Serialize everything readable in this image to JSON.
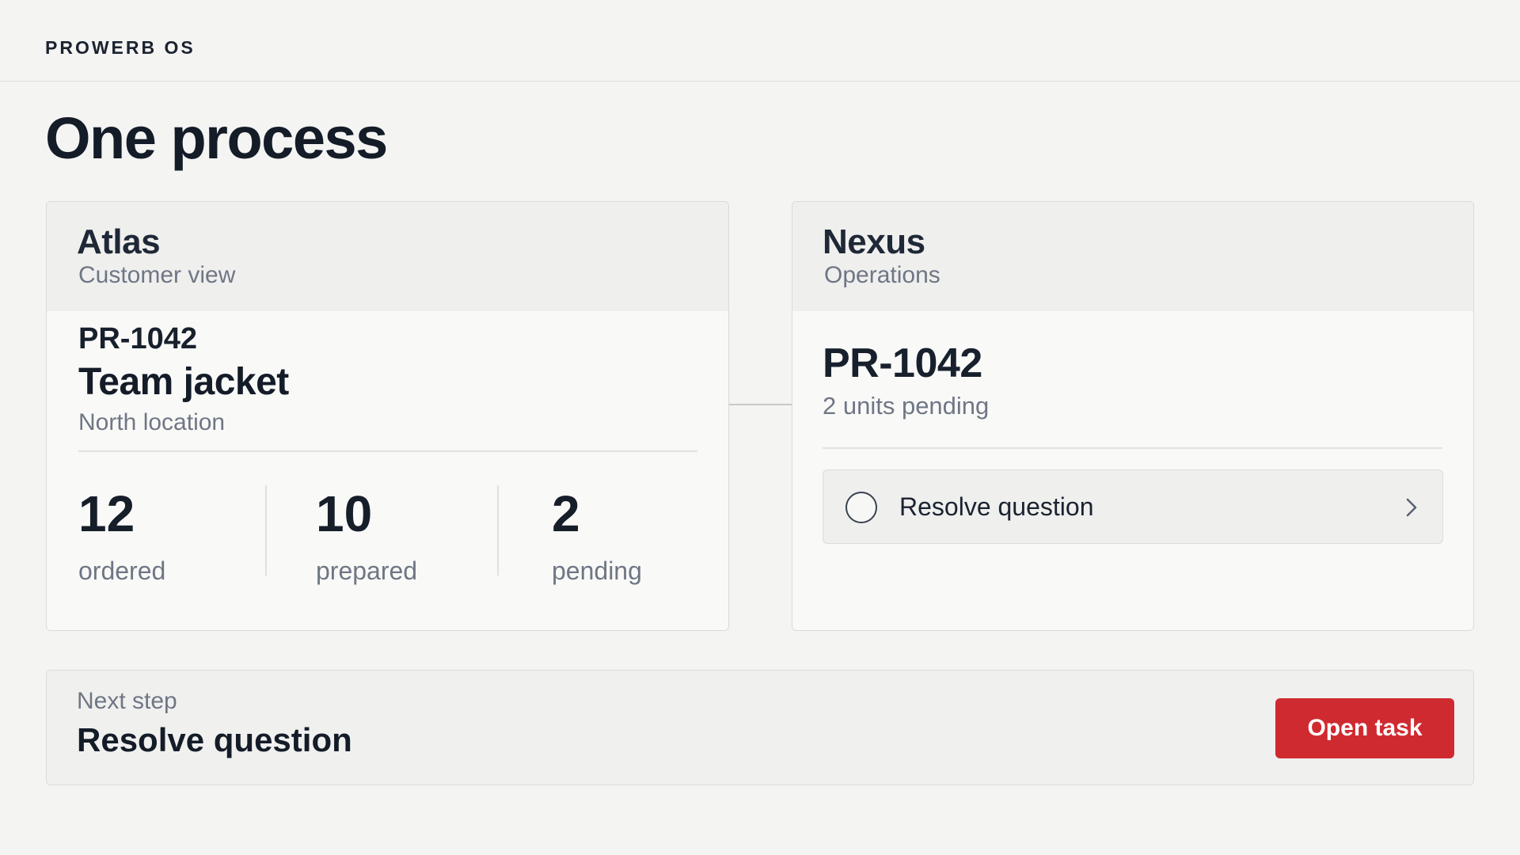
{
  "header": {
    "brand": "PROWERB OS"
  },
  "page": {
    "title": "One process"
  },
  "atlas": {
    "title": "Atlas",
    "subtitle": "Customer view",
    "order_id": "PR-1042",
    "product": "Team jacket",
    "location": "North location",
    "stats": [
      {
        "value": "12",
        "label": "ordered"
      },
      {
        "value": "10",
        "label": "prepared"
      },
      {
        "value": "2",
        "label": "pending"
      }
    ]
  },
  "nexus": {
    "title": "Nexus",
    "subtitle": "Operations",
    "order_id": "PR-1042",
    "pending_text": "2 units pending",
    "task": {
      "label": "Resolve question",
      "icon": "chevron-right-icon"
    }
  },
  "next_step": {
    "label": "Next step",
    "title": "Resolve question",
    "button_label": "Open task"
  },
  "colors": {
    "accent": "#cf2a30",
    "background": "#f4f4f3",
    "text_primary": "#141c28",
    "text_muted": "#6f7684"
  }
}
